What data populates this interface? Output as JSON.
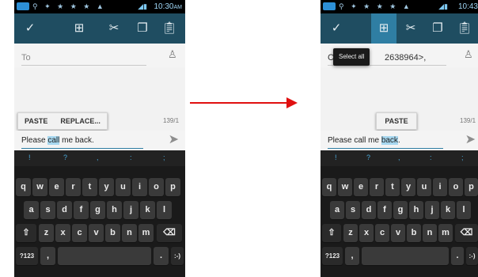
{
  "left": {
    "time": "10:30",
    "time_suffix": "AM",
    "to_placeholder": "To",
    "popup": {
      "paste": "PASTE",
      "replace": "REPLACE..."
    },
    "counter": "139/1",
    "message": {
      "before": "Please ",
      "selected": "call",
      "after": " me back."
    }
  },
  "right": {
    "time": "10:43",
    "to_prefix": "C",
    "to_value": "2638964>,",
    "tooltip": "Select all",
    "popup": {
      "paste": "PASTE"
    },
    "counter": "139/1",
    "message": {
      "before": "Please call me ",
      "selected": "back",
      "after": "."
    }
  },
  "keyboard": {
    "suggestions": [
      "!",
      "?",
      ",",
      ":",
      ";"
    ],
    "row1": [
      "q",
      "w",
      "e",
      "r",
      "t",
      "y",
      "u",
      "i",
      "o",
      "p"
    ],
    "row2": [
      "a",
      "s",
      "d",
      "f",
      "g",
      "h",
      "j",
      "k",
      "l"
    ],
    "row3": [
      "z",
      "x",
      "c",
      "v",
      "b",
      "n",
      "m"
    ],
    "symbols_label": "?123",
    "comma": ",",
    "period": ".",
    "smiley": ":-)"
  },
  "icons": {
    "check": "check-icon",
    "select_all": "select-all-icon",
    "cut": "cut-icon",
    "copy": "copy-icon",
    "paste": "paste-icon",
    "contact": "add-contact-icon",
    "send": "send-icon",
    "shift": "shift-icon",
    "delete": "delete-icon"
  },
  "colors": {
    "action_bar": "#1f4d61",
    "selection_highlight": "#a8d8f0",
    "handle": "#3c9ed4",
    "arrow": "#e01010"
  }
}
